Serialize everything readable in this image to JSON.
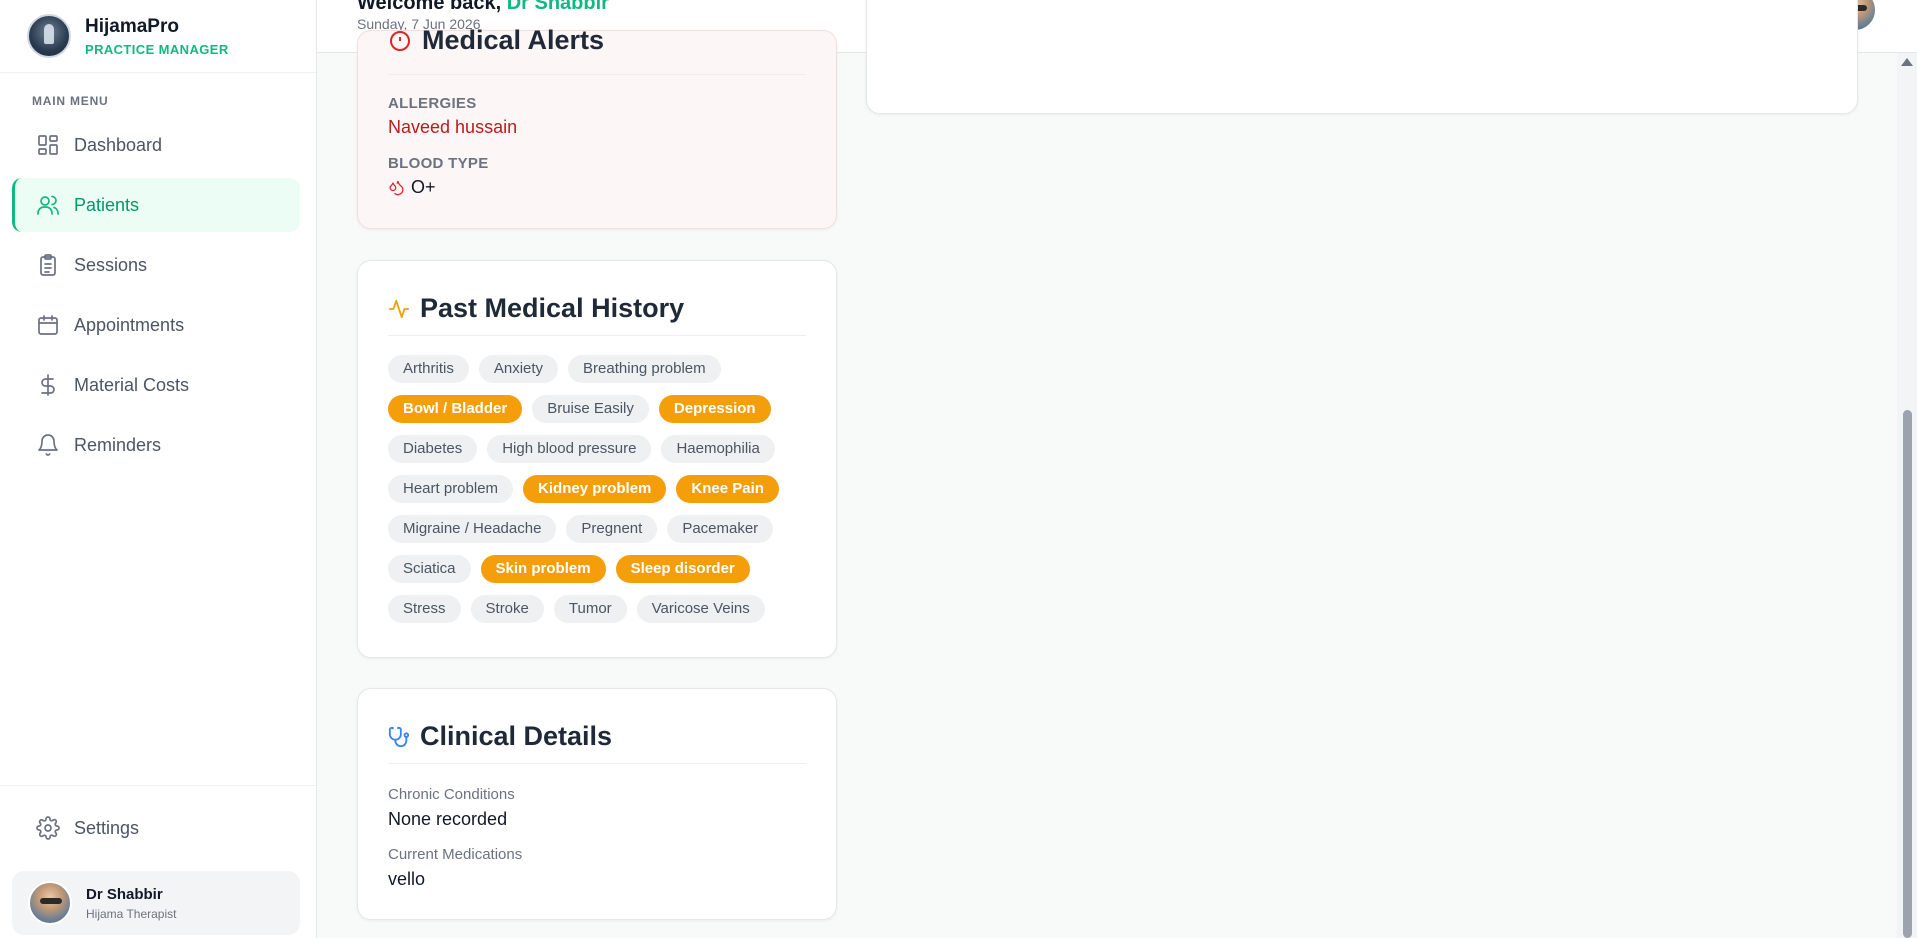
{
  "brand": {
    "name": "HijamaPro",
    "subtitle": "PRACTICE MANAGER"
  },
  "sidebar": {
    "menu_title": "MAIN MENU",
    "items": [
      {
        "label": "Dashboard",
        "icon": "dashboard-icon"
      },
      {
        "label": "Patients",
        "icon": "users-icon",
        "active": true
      },
      {
        "label": "Sessions",
        "icon": "clipboard-icon"
      },
      {
        "label": "Appointments",
        "icon": "calendar-icon"
      },
      {
        "label": "Material Costs",
        "icon": "dollar-icon"
      },
      {
        "label": "Reminders",
        "icon": "bell-icon"
      }
    ],
    "settings_label": "Settings",
    "user": {
      "name": "Dr Shabbir",
      "role": "Hijama Therapist"
    }
  },
  "header": {
    "welcome_prefix": "Welcome back,",
    "welcome_name": "Dr Shabbir",
    "date": "Sunday, 7 Jun 2026"
  },
  "medical_alerts": {
    "title": "Medical Alerts",
    "allergies_label": "ALLERGIES",
    "allergies_value": "Naveed hussain",
    "blood_type_label": "BLOOD TYPE",
    "blood_type_value": "O+"
  },
  "past_history": {
    "title": "Past Medical History",
    "rows": [
      [
        {
          "label": "Arthritis",
          "on": false
        },
        {
          "label": "Anxiety",
          "on": false
        },
        {
          "label": "Breathing problem",
          "on": false
        }
      ],
      [
        {
          "label": "Bowl / Bladder",
          "on": true
        },
        {
          "label": "Bruise Easily",
          "on": false
        },
        {
          "label": "Depression",
          "on": true
        }
      ],
      [
        {
          "label": "Diabetes",
          "on": false
        },
        {
          "label": "High blood pressure",
          "on": false
        },
        {
          "label": "Haemophilia",
          "on": false
        }
      ],
      [
        {
          "label": "Heart problem",
          "on": false
        },
        {
          "label": "Kidney problem",
          "on": true
        },
        {
          "label": "Knee Pain",
          "on": true
        }
      ],
      [
        {
          "label": "Migraine / Headache",
          "on": false
        },
        {
          "label": "Pregnent",
          "on": false
        },
        {
          "label": "Pacemaker",
          "on": false
        }
      ],
      [
        {
          "label": "Sciatica",
          "on": false
        },
        {
          "label": "Skin problem",
          "on": true
        },
        {
          "label": "Sleep disorder",
          "on": true
        }
      ],
      [
        {
          "label": "Stress",
          "on": false
        },
        {
          "label": "Stroke",
          "on": false
        },
        {
          "label": "Tumor",
          "on": false
        },
        {
          "label": "Varicose Veins",
          "on": false
        }
      ]
    ]
  },
  "clinical": {
    "title": "Clinical Details",
    "chronic_label": "Chronic Conditions",
    "chronic_value": "None recorded",
    "meds_label": "Current Medications",
    "meds_value": "vello"
  },
  "colors": {
    "accent": "#10b981",
    "highlight_chip": "#f59e0b",
    "alert_red": "#b91c1c"
  }
}
